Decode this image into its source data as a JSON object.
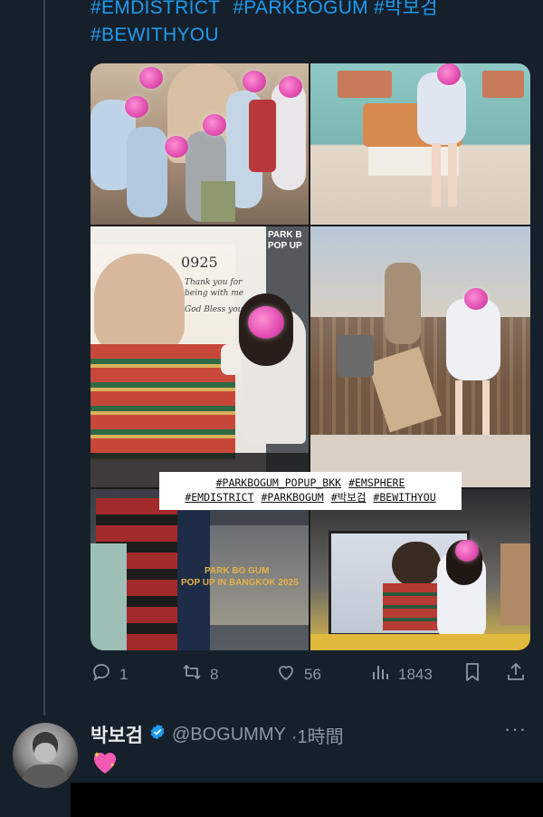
{
  "tweet": {
    "hashtags": [
      "#EMDISTRICT",
      "#PARKBOGUM",
      "#박보검",
      "#BEWITHYOU"
    ],
    "image_overlay_tags": [
      "#PARKBOGUM_POPUP_BKK",
      "#EMSPHERE",
      "#EMDISTRICT",
      "#PARKBOGUM",
      "#박보검",
      "#BEWITHYOU"
    ],
    "image_texts": {
      "popup_sign": "PARK B",
      "popup_sign2": "POP UP",
      "signature_number": "0925",
      "note_line1": "Thank you for",
      "note_line2": "being with me",
      "note_line3": "God Bless you",
      "banner_line1": "PARK BO GUM",
      "banner_line2": "POP UP IN BANGKOK 2025"
    },
    "actions": {
      "reply_count": "1",
      "retweet_count": "8",
      "like_count": "56",
      "view_count": "1843"
    }
  },
  "reply": {
    "display_name": "박보검",
    "handle": "@BOGUMMY",
    "time": "·1時間",
    "more_label": "···"
  },
  "colors": {
    "background": "#15202b",
    "link": "#1d9bf0",
    "muted": "#8b98a5",
    "verified": "#1d9bf0"
  },
  "icons": [
    "reply-icon",
    "retweet-icon",
    "like-icon",
    "views-icon",
    "bookmark-icon",
    "share-icon",
    "verified-badge-icon",
    "sparkling-heart-icon",
    "more-icon"
  ]
}
